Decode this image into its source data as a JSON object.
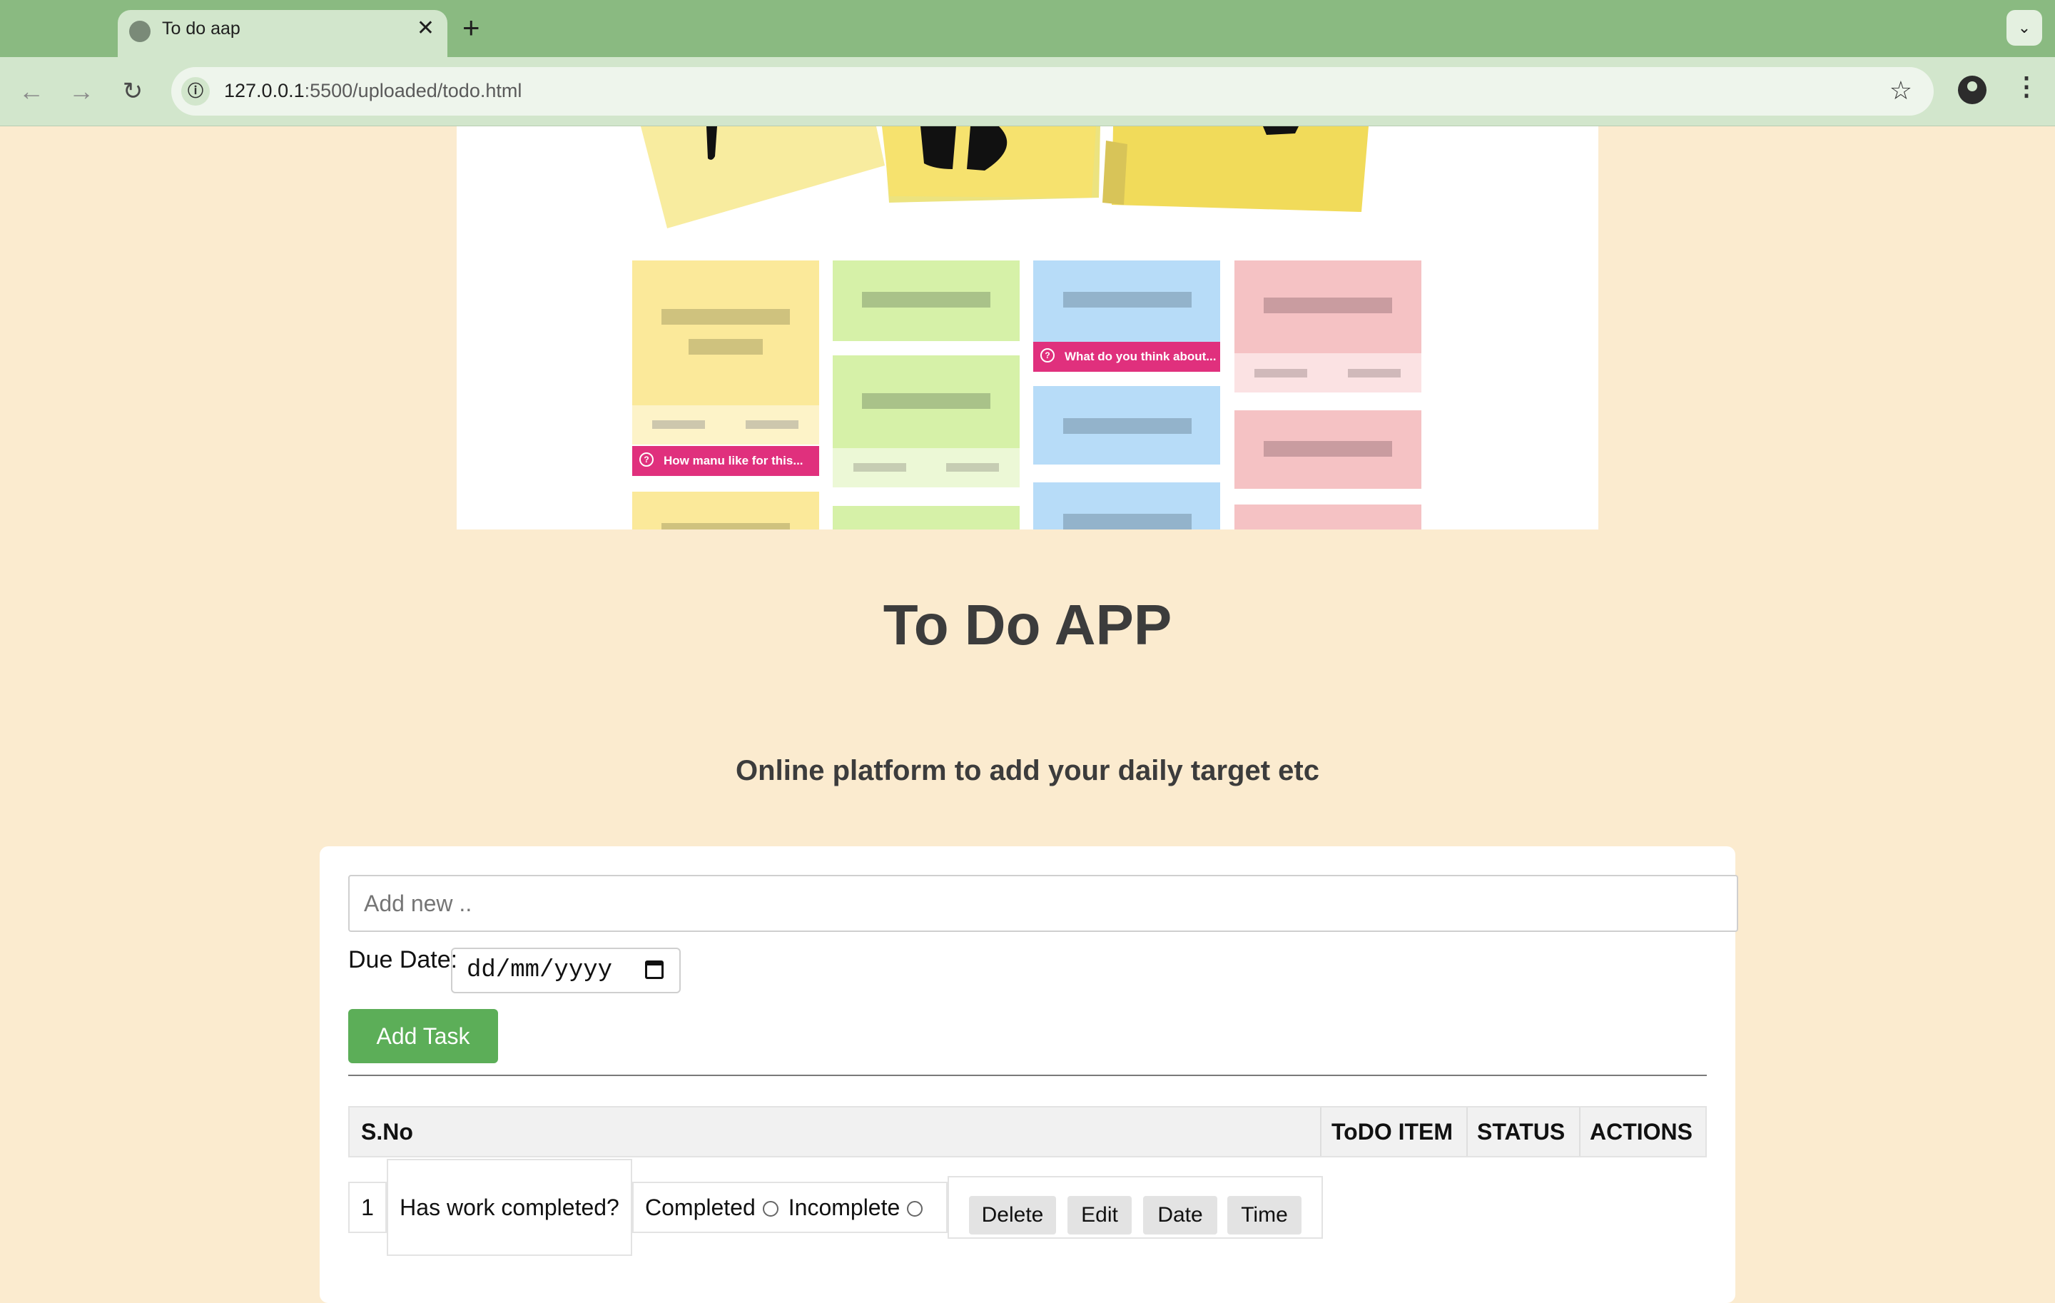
{
  "browser": {
    "tab_title": "To do aap",
    "tab_close": "✕",
    "new_tab": "+",
    "tab_list": "⌄",
    "back": "←",
    "forward": "→",
    "reload": "↻",
    "site_info": "ⓘ",
    "url_host": "127.0.0.1",
    "url_rest": ":5500/uploaded/todo.html",
    "bookmark": "☆",
    "menu": "⋮"
  },
  "hero": {
    "chip_yellow": "How manu like for this...",
    "chip_blue": "What do you think about...",
    "colors": {
      "yellow": "#fbe99a",
      "green": "#d6f1a8",
      "blue": "#b7dcf8",
      "pink": "#f5c2c4",
      "chip": "#e0307d"
    }
  },
  "page": {
    "title": "To Do APP",
    "subtitle": "Online platform to add your daily target etc"
  },
  "form": {
    "input_placeholder": "Add new ..",
    "due_label": "Due Date:",
    "date_placeholder": "dd/mm/yyyy",
    "add_button": "Add Task"
  },
  "table": {
    "headers": [
      "S.No",
      "ToDO ITEM",
      "STATUS",
      "ACTIONS"
    ],
    "rows": [
      {
        "sno": "1",
        "item": "Has work completed?",
        "status_completed": "Completed",
        "status_incomplete": "Incomplete",
        "actions": [
          "Delete",
          "Edit",
          "Date",
          "Time"
        ]
      }
    ]
  },
  "colors": {
    "page_bg": "#fbebcf",
    "accent_green": "#5cae58",
    "chrome": "#8aba81"
  }
}
